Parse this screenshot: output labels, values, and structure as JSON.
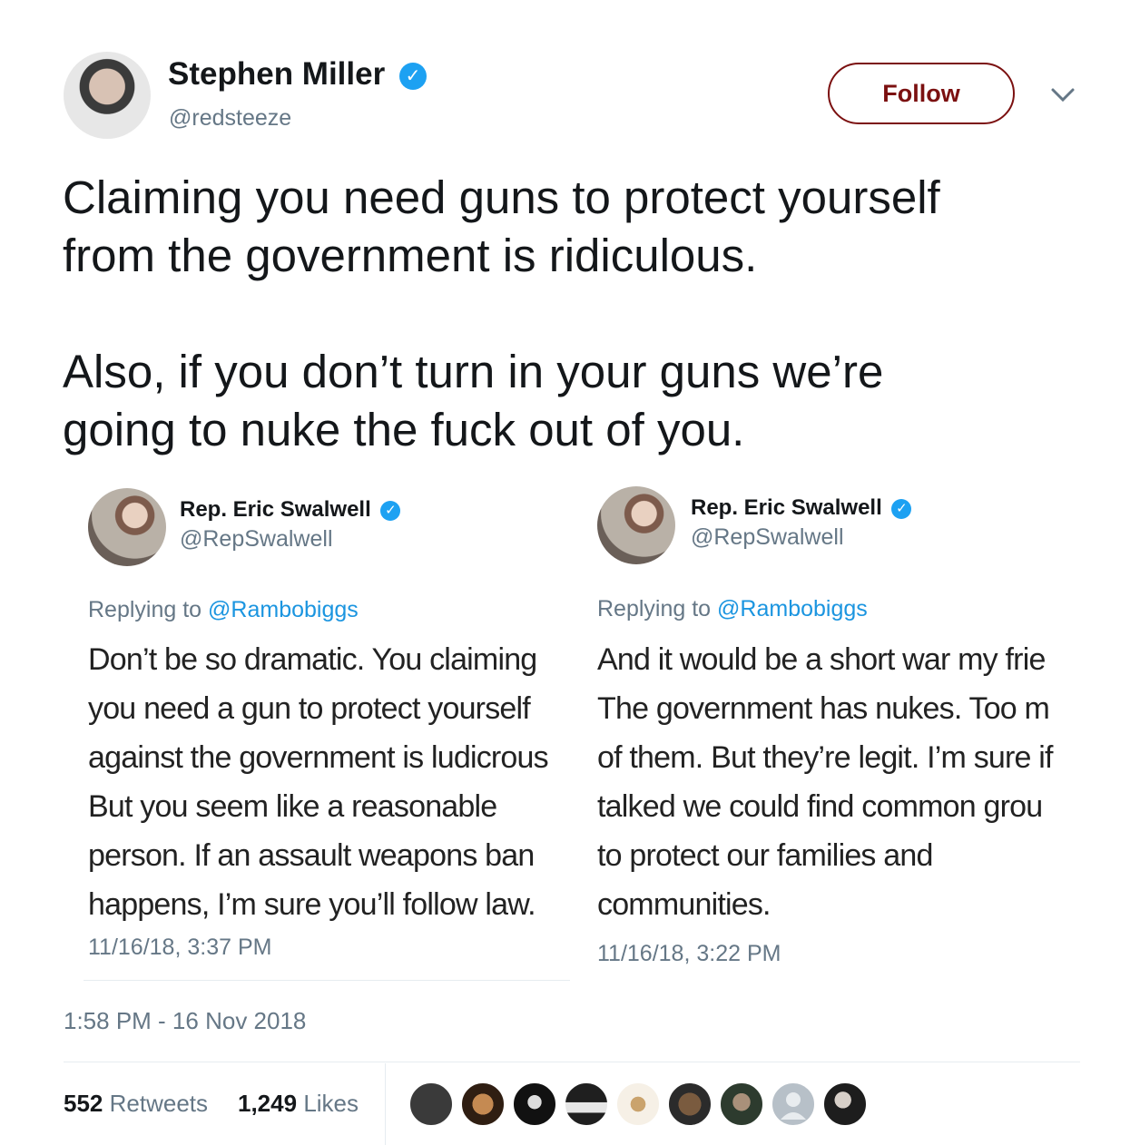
{
  "author": {
    "name": "Stephen Miller",
    "handle": "@redsteeze",
    "verified_glyph": "✓"
  },
  "follow_label": "Follow",
  "tweet_text": "Claiming you need guns to protect yourself\nfrom the government is ridiculous.\n\nAlso, if you don’t turn in your guns we’re\ngoing to nuke the fuck out of you.",
  "quoted": [
    {
      "name": "Rep. Eric Swalwell",
      "handle": "@RepSwalwell",
      "reply_prefix": "Replying to ",
      "reply_to": "@Rambobiggs",
      "text": "Don’t be so dramatic. You claiming\nyou need a gun to protect yourself\nagainst the government is ludicrous\nBut you seem like a reasonable\nperson. If an assault weapons ban\nhappens, I’m sure you’ll follow law.",
      "timestamp": "11/16/18, 3:37 PM"
    },
    {
      "name": "Rep. Eric Swalwell",
      "handle": "@RepSwalwell",
      "reply_prefix": "Replying to ",
      "reply_to": "@Rambobiggs",
      "text": "And it would be a short war my frie\nThe government has nukes. Too m\nof them. But they’re legit. I’m sure if\ntalked we could find common grou\nto protect our families and\ncommunities.",
      "timestamp": "11/16/18, 3:22 PM"
    }
  ],
  "tweet_time": "1:58 PM - 16 Nov 2018",
  "stats": {
    "retweets_count": "552",
    "retweets_label": "Retweets",
    "likes_count": "1,249",
    "likes_label": "Likes"
  },
  "icons": {
    "chevron": "chevron-down-icon",
    "verified": "verified-badge-icon"
  },
  "colors": {
    "follow_border": "#7b1010",
    "verified_blue": "#1da1f2",
    "link_blue": "#1b95e0",
    "muted_gray": "#657786"
  }
}
